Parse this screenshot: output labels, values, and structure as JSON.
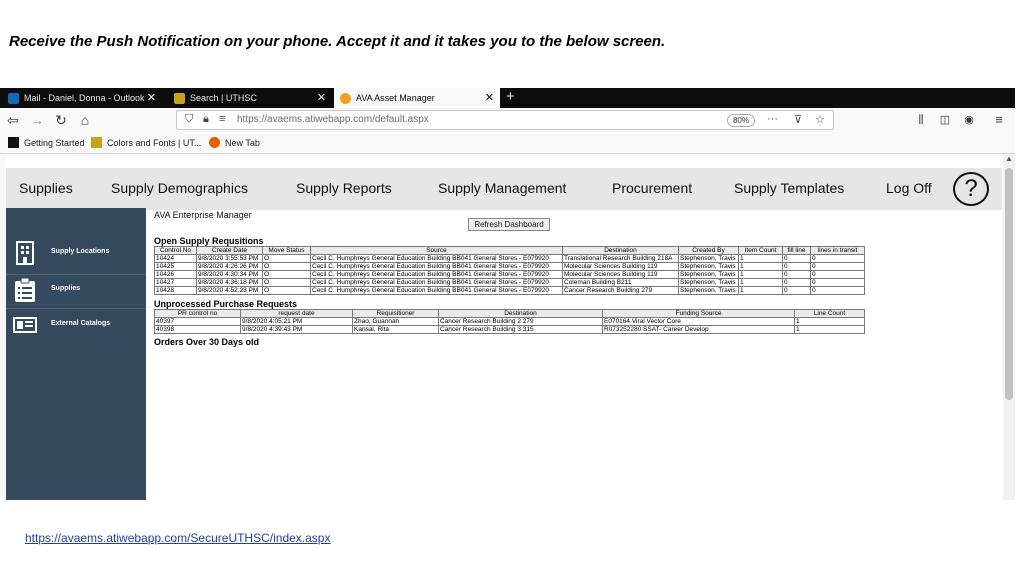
{
  "caption": "Receive the Push Notification on your phone. Accept it and it takes you to the below screen.",
  "footer_link": "https://avaems.atiwebapp.com/SecureUTHSC/index.aspx",
  "browser": {
    "tabs": [
      {
        "label": "Mail - Daniel, Donna - Outlook",
        "icon": "outlook-icon",
        "active": false
      },
      {
        "label": "Search | UTHSC",
        "icon": "uthsc-icon",
        "active": false
      },
      {
        "label": "AVA Asset Manager",
        "icon": "ava-icon",
        "active": true
      }
    ],
    "new_tab_symbol": "+",
    "url": "https://avaems.atiwebapp.com/default.aspx",
    "zoom": "80%",
    "bookmarks": [
      {
        "label": "Getting Started",
        "icon": "mdn-icon"
      },
      {
        "label": "Colors and Fonts | UT...",
        "icon": "uthsc-icon"
      },
      {
        "label": "New Tab",
        "icon": "firefox-icon"
      }
    ]
  },
  "topmenu": {
    "items": [
      "Supplies",
      "Supply Demographics",
      "Supply Reports",
      "Supply Management",
      "Procurement",
      "Supply Templates",
      "Log Off"
    ],
    "help_symbol": "?"
  },
  "sidebar": {
    "items": [
      {
        "label": "Supply Locations",
        "icon": "building-icon"
      },
      {
        "label": "Supplies",
        "icon": "clipboard-list-icon"
      },
      {
        "label": "External Catalogs",
        "icon": "catalog-icon"
      }
    ]
  },
  "main": {
    "app_title": "AVA Enterprise Manager",
    "refresh_label": "Refresh Dashboard",
    "open_requisitions": {
      "title": "Open Supply Requsitions",
      "columns": [
        "Control No",
        "Create Date",
        "Move Status",
        "Source",
        "Destination",
        "Created By",
        "Item Count",
        "fill line",
        "lines in transit"
      ],
      "rows": [
        [
          "10424",
          "9/8/2020 3:55:53 PM",
          "O",
          "Cecil C. Humphreys General Education Building BB041 General Stores - E079920",
          "Translational Research Building 218A",
          "Stephenson, Travis",
          "1",
          "0",
          "0"
        ],
        [
          "10425",
          "9/8/2020 4:26:26 PM",
          "O",
          "Cecil C. Humphreys General Education Building BB041 General Stores - E079920",
          "Molecular Sciences Building 119",
          "Stephenson, Travis",
          "1",
          "0",
          "0"
        ],
        [
          "10426",
          "9/8/2020 4:30:34 PM",
          "O",
          "Cecil C. Humphreys General Education Building BB041 General Stores - E079920",
          "Molecular Sciences Building 119",
          "Stephenson, Travis",
          "1",
          "0",
          "0"
        ],
        [
          "10427",
          "9/8/2020 4:36:18 PM",
          "O",
          "Cecil C. Humphreys General Education Building BB041 General Stores - E079920",
          "Coleman Building B211",
          "Stephenson, Travis",
          "1",
          "0",
          "0"
        ],
        [
          "10428",
          "9/8/2020 4:52:23 PM",
          "O",
          "Cecil C. Humphreys General Education Building BB041 General Stores - E079920",
          "Cancer Research Building 279",
          "Stephenson, Travis",
          "1",
          "0",
          "0"
        ]
      ]
    },
    "unprocessed_pr": {
      "title": "Unprocessed Purchase Requests",
      "columns": [
        "PR control no",
        "request date",
        "Requisitioner",
        "Destination",
        "Funding Source",
        "Line Count"
      ],
      "rows": [
        [
          "40397",
          "9/8/2020 4:05:21 PM",
          "Zhao, Guannan",
          "Cancer Research Building 2 279",
          "E070164 Viral Vector Core",
          "1"
        ],
        [
          "40398",
          "9/8/2020 4:39:43 PM",
          "Kansal, Rita",
          "Cancer Research Building 3 315",
          "R073252280 SSAT- Career Develop",
          "1"
        ]
      ]
    },
    "orders_over_30": {
      "title": "Orders Over 30 Days old"
    }
  }
}
